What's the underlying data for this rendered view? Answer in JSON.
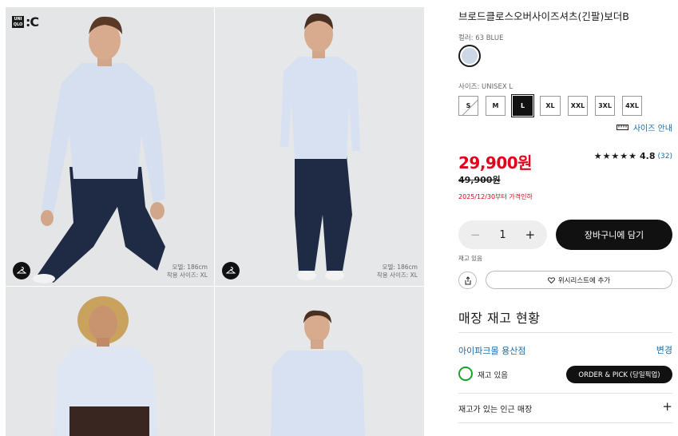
{
  "brand": {
    "box_text": "UNI QLO",
    "mark": ":C"
  },
  "gallery": {
    "images": [
      {
        "alt": "model-front-walking",
        "model_info_line1": "모델: 186cm",
        "model_info_line2": "착용 사이즈: XL"
      },
      {
        "alt": "model-walking-full",
        "model_info_line1": "모델: 186cm",
        "model_info_line2": "착용 사이즈: XL"
      },
      {
        "alt": "female-model-front"
      },
      {
        "alt": "male-model-front"
      }
    ]
  },
  "product": {
    "title": "브로드클로스오버사이즈셔츠(긴팔)보더B",
    "color_label": "컬러: 63 BLUE",
    "swatch_color": "#cdd7e6",
    "size_label": "사이즈: UNISEX L",
    "sizes": [
      {
        "label": "S",
        "state": "unavailable"
      },
      {
        "label": "M",
        "state": "available"
      },
      {
        "label": "L",
        "state": "selected"
      },
      {
        "label": "XL",
        "state": "available"
      },
      {
        "label": "XXL",
        "state": "available"
      },
      {
        "label": "3XL",
        "state": "available"
      },
      {
        "label": "4XL",
        "state": "available"
      }
    ],
    "size_guide": "사이즈 안내",
    "price": "29,900원",
    "original_price": "49,900원",
    "sale_note": "2025/12/30부터 가격인하",
    "rating": {
      "stars": "★★★★★",
      "score": "4.8",
      "count": "(32)"
    },
    "quantity": {
      "minus": "−",
      "value": "1",
      "plus": "+"
    },
    "add_to_cart": "장바구니에 담기",
    "stock_text": "재고 있음",
    "wishlist": "위시리스트에 추가"
  },
  "store": {
    "title": "매장 재고 현황",
    "name": "아이파크몰 용산점",
    "change": "변경",
    "stock_status": "재고 있음",
    "order_pick": "ORDER & PICK (당일픽업)",
    "nearby": "재고가 있는 인근 매장",
    "nearby_expand": "+"
  },
  "colors": {
    "sale_red": "#e2001a",
    "link_blue": "#1b6ca8",
    "in_stock_green": "#19a32b"
  },
  "icons": [
    "hanger-icon",
    "ruler-icon",
    "share-icon",
    "heart-icon",
    "plus-icon"
  ]
}
